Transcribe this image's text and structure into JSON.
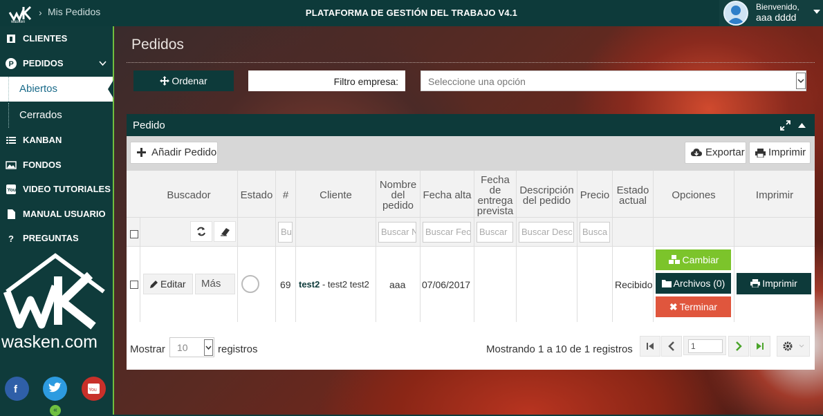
{
  "header": {
    "breadcrumb": "Mis Pedidos",
    "app_title": "PLATAFORMA DE GESTIÓN DEL TRABAJO V4.1",
    "welcome": "Bienvenido,",
    "username": "aaa dddd"
  },
  "sidebar": {
    "items": [
      {
        "label": "CLIENTES",
        "icon": "id-card-icon"
      },
      {
        "label": "PEDIDOS",
        "icon": "pedidos-icon"
      },
      {
        "label": "Abiertos"
      },
      {
        "label": "Cerrados"
      },
      {
        "label": "KANBAN",
        "icon": "list-icon"
      },
      {
        "label": "FONDOS",
        "icon": "image-icon"
      },
      {
        "label": "VIDEO TUTORIALES",
        "icon": "youtube-icon"
      },
      {
        "label": "MANUAL USUARIO",
        "icon": "file-icon"
      },
      {
        "label": "PREGUNTAS",
        "icon": "question-icon"
      }
    ],
    "brand": "wasken.com",
    "brand_logo_text": "wasken.com"
  },
  "page": {
    "title": "Pedidos",
    "ordenar_label": "Ordenar",
    "filtro_label": "Filtro empresa:",
    "filtro_placeholder": "Seleccione una opción"
  },
  "panel": {
    "title": "Pedido",
    "add_label": "Añadir Pedido",
    "export_label": "Exportar",
    "print_label": "Imprimir"
  },
  "table": {
    "headers": {
      "buscador": "Buscador",
      "estado": "Estado",
      "num": "#",
      "cliente": "Cliente",
      "nombre_l1": "Nombre",
      "nombre_l2": "del",
      "nombre_l3": "pedido",
      "fecha_alta": "Fecha alta",
      "fep_l1": "Fecha",
      "fep_l2": "de",
      "fep_l3": "entrega",
      "fep_l4": "prevista",
      "desc_l1": "Descripción",
      "desc_l2": "del pedido",
      "precio": "Precio",
      "ea_l1": "Estado",
      "ea_l2": "actual",
      "opciones": "Opciones",
      "imprimir": "Imprimir"
    },
    "filter_placeholders": {
      "num": "Bu",
      "nombre": "Buscar N",
      "fecha": "Buscar Fec",
      "fep": "Buscar",
      "desc": "Buscar Desc",
      "precio": "Busca"
    },
    "row": {
      "editar": "Editar",
      "mas": "Más",
      "num": "69",
      "cliente_bold": "test2",
      "cliente_rest": " - test2 test2",
      "nombre": "aaa",
      "fecha_alta": "07/06/2017",
      "estado_actual": "Recibido",
      "cambiar": "Cambiar",
      "archivos": "Archivos (0)",
      "terminar": "Terminar",
      "imprimir": "Imprimir"
    }
  },
  "footer": {
    "mostrar": "Mostrar",
    "page_size": "10",
    "registros": "registros",
    "info": "Mostrando 1 a 10 de 1 registros",
    "page_input": "1"
  },
  "colors": {
    "primary": "#0d3a3a",
    "accent_green": "#6fbf3f",
    "cambiar_green": "#7cc42b",
    "terminar_red": "#e0563d"
  }
}
